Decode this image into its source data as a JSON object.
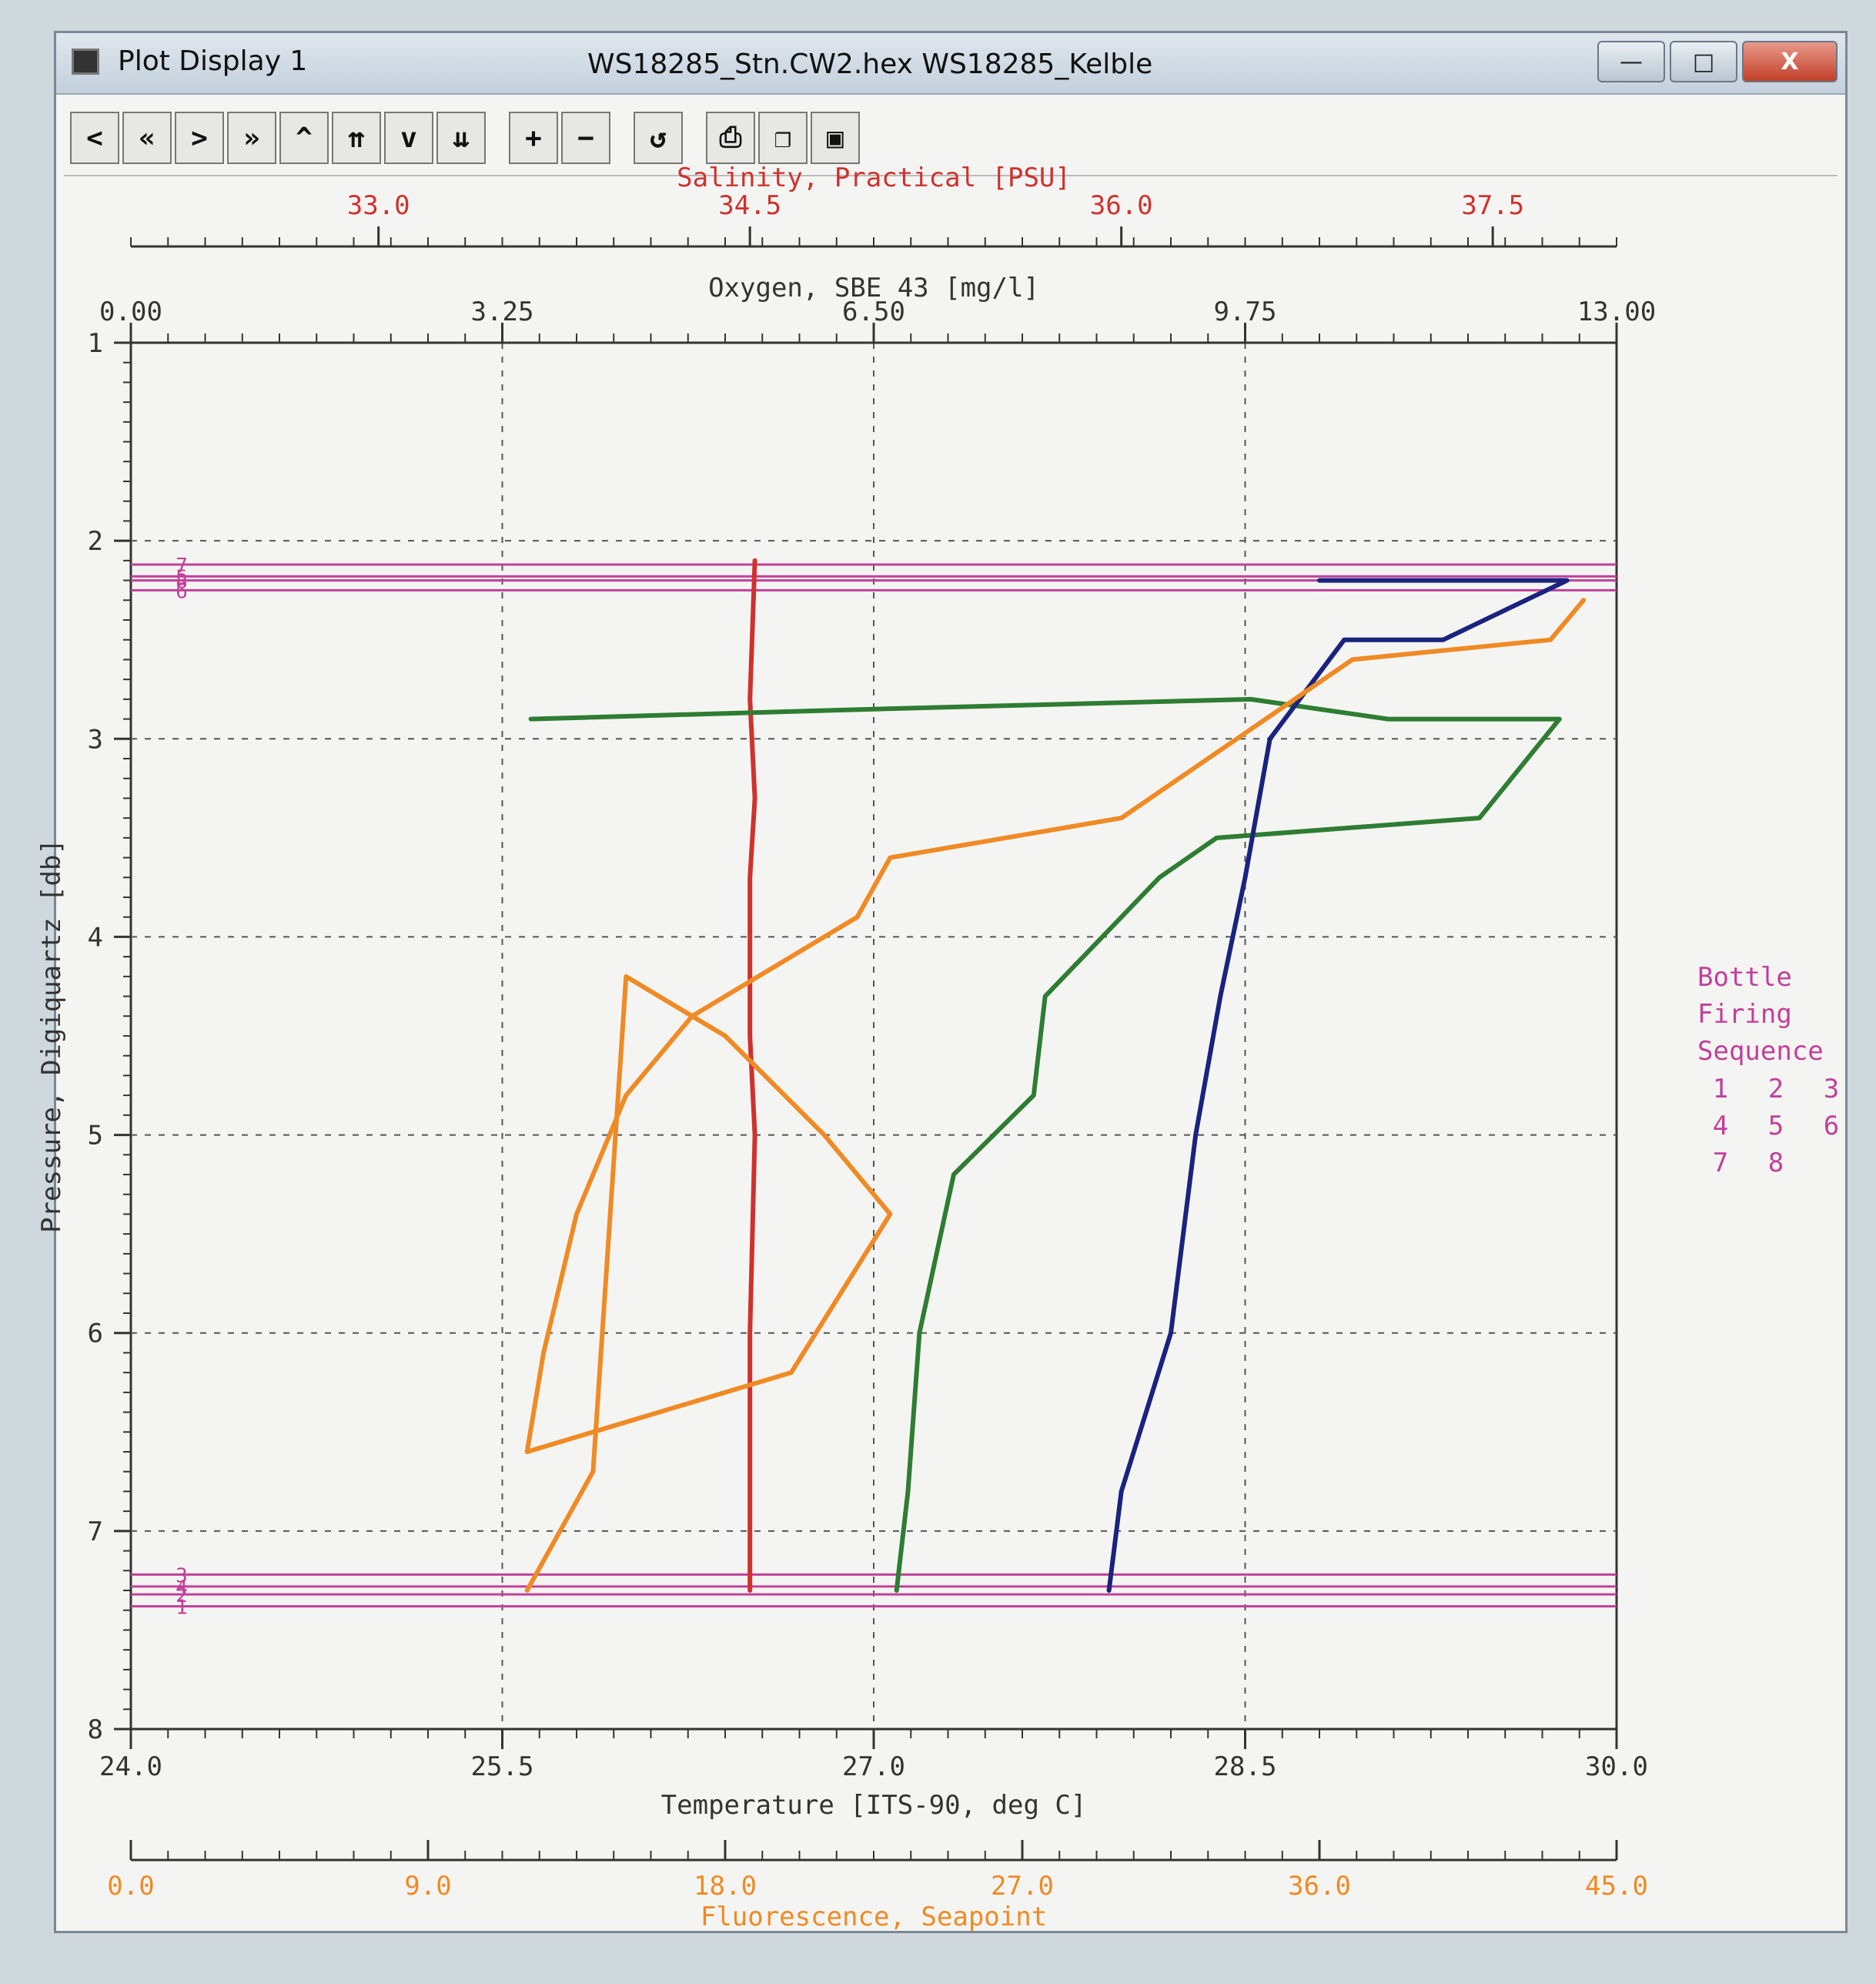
{
  "window": {
    "title": "Plot Display 1",
    "file_title": "WS18285_Stn.CW2.hex WS18285_Kelble",
    "minimize": "—",
    "maximize": "□",
    "close": "X"
  },
  "toolbar": {
    "buttons": [
      {
        "glyph": "<"
      },
      {
        "glyph": "«"
      },
      {
        "glyph": ">"
      },
      {
        "glyph": "»"
      },
      {
        "glyph": "^"
      },
      {
        "glyph": "⇈"
      },
      {
        "glyph": "v"
      },
      {
        "glyph": "⇊"
      },
      {
        "glyph": "+"
      },
      {
        "glyph": "−"
      },
      {
        "glyph": "↺"
      },
      {
        "glyph": "⎙"
      },
      {
        "glyph": "❐"
      },
      {
        "glyph": "▣"
      }
    ]
  },
  "colors": {
    "salinity": "#d0312d",
    "oxygen": "#2e7d32",
    "temperature": "#1a237e",
    "fluorescence": "#f08a24",
    "bottle": "#c2409a",
    "axis": "#333333"
  },
  "chart_data": {
    "type": "line",
    "legend_position": "right",
    "y_axis": {
      "label": "Pressure, Digiquartz [db]",
      "range": [
        1,
        8
      ],
      "ticks": [
        "1",
        "2",
        "3",
        "4",
        "5",
        "6",
        "7",
        "8"
      ],
      "inverted": true
    },
    "x_axes": [
      {
        "key": "salinity",
        "label": "Salinity, Practical [PSU]",
        "range": [
          32.0,
          38.0
        ],
        "ticks": [
          "33.0",
          "34.5",
          "36.0",
          "37.5"
        ],
        "tick_values": [
          33.0,
          34.5,
          36.0,
          37.5
        ]
      },
      {
        "key": "oxygen",
        "label": "Oxygen, SBE 43 [mg/l]",
        "range": [
          0.0,
          13.0
        ],
        "ticks": [
          "0.00",
          "3.25",
          "6.50",
          "9.75",
          "13.00"
        ],
        "tick_values": [
          0.0,
          3.25,
          6.5,
          9.75,
          13.0
        ]
      },
      {
        "key": "temperature",
        "label": "Temperature [ITS-90, deg C]",
        "range": [
          24.0,
          30.0
        ],
        "ticks": [
          "24.0",
          "25.5",
          "27.0",
          "28.5",
          "30.0"
        ],
        "tick_values": [
          24.0,
          25.5,
          27.0,
          28.5,
          30.0
        ]
      },
      {
        "key": "fluorescence",
        "label": "Fluorescence, Seapoint",
        "range": [
          0.0,
          45.0
        ],
        "ticks": [
          "0.0",
          "9.0",
          "18.0",
          "27.0",
          "36.0",
          "45.0"
        ],
        "tick_values": [
          0,
          9,
          18,
          27,
          36,
          45
        ]
      }
    ],
    "series": [
      {
        "key": "salinity",
        "x": [
          34.52,
          34.5,
          34.52,
          34.5,
          34.5,
          34.52,
          34.5,
          34.5
        ],
        "y": [
          2.1,
          2.8,
          3.3,
          3.7,
          4.5,
          5.0,
          6.0,
          7.3
        ]
      },
      {
        "key": "oxygen",
        "x": [
          3.5,
          6.5,
          9.8,
          11.0,
          12.5,
          11.8,
          9.5,
          9.0,
          8.0,
          7.9,
          7.2,
          6.9,
          6.8,
          6.7
        ],
        "y": [
          2.9,
          2.85,
          2.8,
          2.9,
          2.9,
          3.4,
          3.5,
          3.7,
          4.3,
          4.8,
          5.2,
          6.0,
          6.8,
          7.3
        ]
      },
      {
        "key": "temperature",
        "x": [
          28.8,
          29.8,
          29.3,
          28.9,
          28.6,
          28.5,
          28.4,
          28.3,
          28.2,
          28.0,
          27.95
        ],
        "y": [
          2.2,
          2.2,
          2.5,
          2.5,
          3.0,
          3.7,
          4.3,
          5.0,
          6.0,
          6.8,
          7.3
        ]
      },
      {
        "key": "fluorescence",
        "x": [
          44.0,
          43.0,
          37.0,
          30.0,
          23.0,
          22.0,
          17.0,
          15.0,
          13.5,
          12.5,
          12.0,
          20.0,
          23.0,
          21.0,
          18.0,
          15.0,
          14.0,
          12.0
        ],
        "y": [
          2.3,
          2.5,
          2.6,
          3.4,
          3.6,
          3.9,
          4.4,
          4.8,
          5.4,
          6.1,
          6.6,
          6.2,
          5.4,
          5.0,
          4.5,
          4.2,
          6.7,
          7.3
        ]
      }
    ],
    "bottles": [
      {
        "id": "1",
        "pressure": 7.38
      },
      {
        "id": "2",
        "pressure": 7.32
      },
      {
        "id": "3",
        "pressure": 7.22
      },
      {
        "id": "4",
        "pressure": 7.28
      },
      {
        "id": "5",
        "pressure": 2.18
      },
      {
        "id": "6",
        "pressure": 2.25
      },
      {
        "id": "7",
        "pressure": 2.12
      },
      {
        "id": "8",
        "pressure": 2.2
      }
    ],
    "legend": {
      "title_lines": [
        "Bottle",
        "Firing",
        "Sequence"
      ],
      "rows": [
        [
          "1",
          "2",
          "3"
        ],
        [
          "4",
          "5",
          "6"
        ],
        [
          "7",
          "8",
          ""
        ]
      ]
    }
  }
}
